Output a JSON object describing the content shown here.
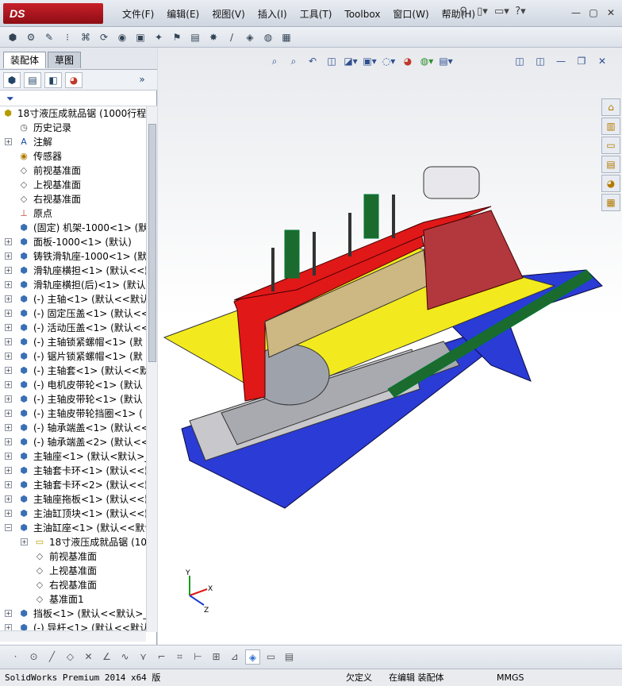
{
  "app": {
    "logo": "DS SOLIDWORKS"
  },
  "menu": [
    "文件(F)",
    "编辑(E)",
    "视图(V)",
    "插入(I)",
    "工具(T)",
    "Toolbox",
    "窗口(W)",
    "帮助(H)"
  ],
  "title_icons": [
    "pushpin-icon",
    "new-doc-icon",
    "open-icon",
    "help-icon"
  ],
  "tabs": {
    "assembly": "装配体",
    "sketch": "草图"
  },
  "tree": {
    "root": "18寸液压成就品锯 (1000行程",
    "items": [
      {
        "label": "历史记录",
        "indent": 1,
        "exp": "",
        "icon": "history"
      },
      {
        "label": "注解",
        "indent": 1,
        "exp": "+",
        "icon": "annotation"
      },
      {
        "label": "传感器",
        "indent": 1,
        "exp": "",
        "icon": "sensor"
      },
      {
        "label": "前视基准面",
        "indent": 1,
        "exp": "",
        "icon": "plane"
      },
      {
        "label": "上视基准面",
        "indent": 1,
        "exp": "",
        "icon": "plane"
      },
      {
        "label": "右视基准面",
        "indent": 1,
        "exp": "",
        "icon": "plane"
      },
      {
        "label": "原点",
        "indent": 1,
        "exp": "",
        "icon": "origin"
      },
      {
        "label": "(固定) 机架-1000<1> (默",
        "indent": 1,
        "exp": "",
        "icon": "part"
      },
      {
        "label": "面板-1000<1> (默认)",
        "indent": 1,
        "exp": "+",
        "icon": "part"
      },
      {
        "label": "铸铁滑轨座-1000<1> (默认",
        "indent": 1,
        "exp": "+",
        "icon": "part"
      },
      {
        "label": "滑轨座横担<1> (默认<<默",
        "indent": 1,
        "exp": "+",
        "icon": "part"
      },
      {
        "label": "滑轨座横担(后)<1> (默认",
        "indent": 1,
        "exp": "+",
        "icon": "part"
      },
      {
        "label": "(-) 主轴<1> (默认<<默认",
        "indent": 1,
        "exp": "+",
        "icon": "part"
      },
      {
        "label": "(-) 固定压盖<1> (默认<<",
        "indent": 1,
        "exp": "+",
        "icon": "part"
      },
      {
        "label": "(-) 活动压盖<1> (默认<<",
        "indent": 1,
        "exp": "+",
        "icon": "part"
      },
      {
        "label": "(-) 主轴锁紧螺帽<1> (默",
        "indent": 1,
        "exp": "+",
        "icon": "part"
      },
      {
        "label": "(-) 锯片锁紧螺帽<1> (默",
        "indent": 1,
        "exp": "+",
        "icon": "part"
      },
      {
        "label": "(-) 主轴套<1> (默认<<默",
        "indent": 1,
        "exp": "+",
        "icon": "part"
      },
      {
        "label": "(-) 电机皮带轮<1> (默认",
        "indent": 1,
        "exp": "+",
        "icon": "part"
      },
      {
        "label": "(-) 主轴皮带轮<1> (默认",
        "indent": 1,
        "exp": "+",
        "icon": "part"
      },
      {
        "label": "(-) 主轴皮带轮挡圈<1> (",
        "indent": 1,
        "exp": "+",
        "icon": "part"
      },
      {
        "label": "(-) 轴承端盖<1> (默认<<",
        "indent": 1,
        "exp": "+",
        "icon": "part"
      },
      {
        "label": "(-) 轴承端盖<2> (默认<<",
        "indent": 1,
        "exp": "+",
        "icon": "part"
      },
      {
        "label": "主轴座<1> (默认<默认>_",
        "indent": 1,
        "exp": "+",
        "icon": "part"
      },
      {
        "label": "主轴套卡环<1> (默认<<默",
        "indent": 1,
        "exp": "+",
        "icon": "part"
      },
      {
        "label": "主轴套卡环<2> (默认<<默",
        "indent": 1,
        "exp": "+",
        "icon": "part"
      },
      {
        "label": "主轴座拖板<1> (默认<<默",
        "indent": 1,
        "exp": "+",
        "icon": "part"
      },
      {
        "label": "主油缸顶块<1> (默认<<默",
        "indent": 1,
        "exp": "+",
        "icon": "part"
      },
      {
        "label": "主油缸座<1> (默认<<默认",
        "indent": 1,
        "exp": "-",
        "icon": "part"
      },
      {
        "label": "18寸液压成就品锯 (10",
        "indent": 2,
        "exp": "+",
        "icon": "folder"
      },
      {
        "label": "前视基准面",
        "indent": 2,
        "exp": "",
        "icon": "plane"
      },
      {
        "label": "上视基准面",
        "indent": 2,
        "exp": "",
        "icon": "plane"
      },
      {
        "label": "右视基准面",
        "indent": 2,
        "exp": "",
        "icon": "plane"
      },
      {
        "label": "基准面1",
        "indent": 2,
        "exp": "",
        "icon": "plane"
      },
      {
        "label": "挡板<1> (默认<<默认>_显",
        "indent": 1,
        "exp": "+",
        "icon": "part"
      },
      {
        "label": "(-) 导杆<1> (默认<<默认",
        "indent": 1,
        "exp": "+",
        "icon": "part"
      }
    ]
  },
  "triad": {
    "y": "Y",
    "x": "X",
    "z": "Z"
  },
  "status": {
    "product": "SolidWorks Premium 2014 x64 版",
    "underdefined": "欠定义",
    "editing": "在编辑 装配体",
    "units": "MMGS"
  }
}
